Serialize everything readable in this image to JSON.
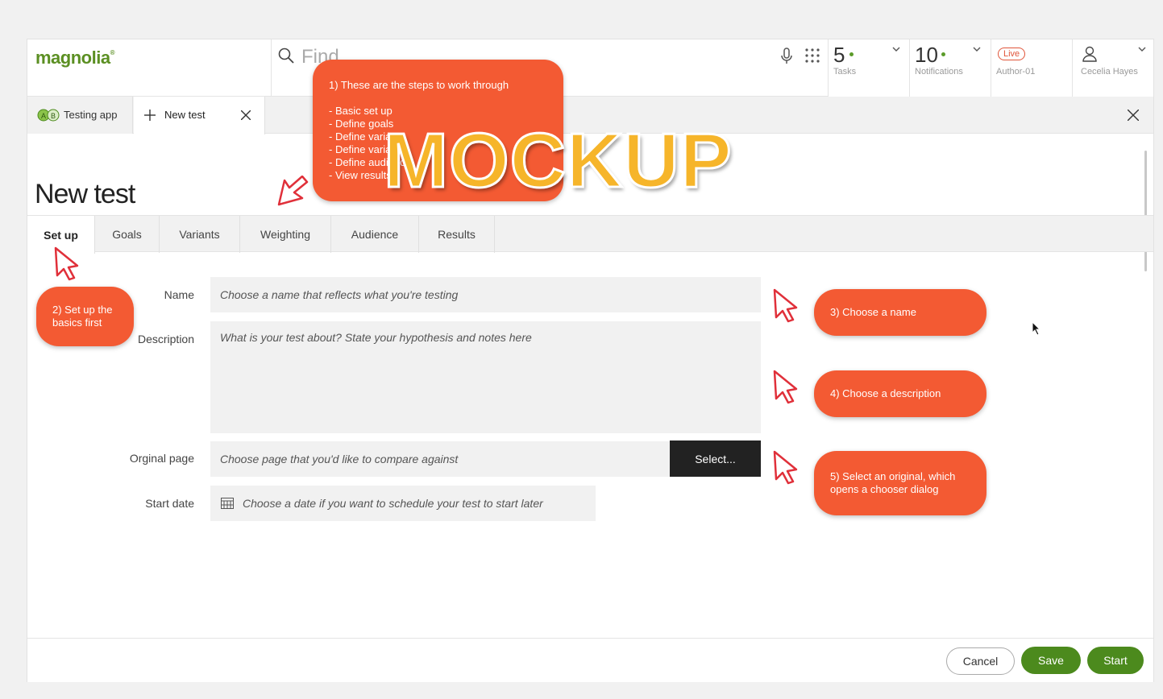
{
  "header": {
    "logo_text": "magnolia",
    "search_placeholder": "Find",
    "tasks": {
      "count": "5",
      "label": "Tasks"
    },
    "notifications": {
      "count": "10",
      "label": "Notifications"
    },
    "environment": {
      "badge": "Live",
      "label": "Author-01"
    },
    "user": {
      "name": "Cecelia Hayes"
    },
    "status_dot_color": "#5b9b2a"
  },
  "tabs": {
    "app_tab_label": "Testing app",
    "app_icon_text": "AB",
    "new_tab_label": "New test"
  },
  "page": {
    "title": "New test"
  },
  "section_tabs": [
    "Set up",
    "Goals",
    "Variants",
    "Weighting",
    "Audience",
    "Results"
  ],
  "form": {
    "name": {
      "label": "Name",
      "placeholder": "Choose a name that reflects what you're testing"
    },
    "description": {
      "label": "Description",
      "placeholder": "What is your test about? State your hypothesis and notes here"
    },
    "original_page": {
      "label": "Orginal page",
      "placeholder": "Choose page that you'd like to compare against",
      "button_label": "Select..."
    },
    "start_date": {
      "label": "Start date",
      "placeholder": "Choose a date if you want to schedule your test to start later"
    }
  },
  "footer": {
    "cancel_label": "Cancel",
    "save_label": "Save",
    "start_label": "Start"
  },
  "annotations": {
    "steps_title": "1) These are the steps to work through",
    "steps": [
      "- Basic set up",
      "- Define goals",
      "- Define variants",
      "- Define variants",
      "- Define audience",
      "- View results"
    ],
    "setup_note": "2) Set up the basics first",
    "name_note": "3) Choose a name",
    "description_note": "4) Choose a description",
    "original_note": "5) Select an original, which opens a chooser dialog",
    "watermark": "MOCKUP",
    "accent_color": "#f35a33"
  },
  "colors": {
    "brand_green": "#4c8a1d",
    "watermark": "#f6b52a"
  }
}
